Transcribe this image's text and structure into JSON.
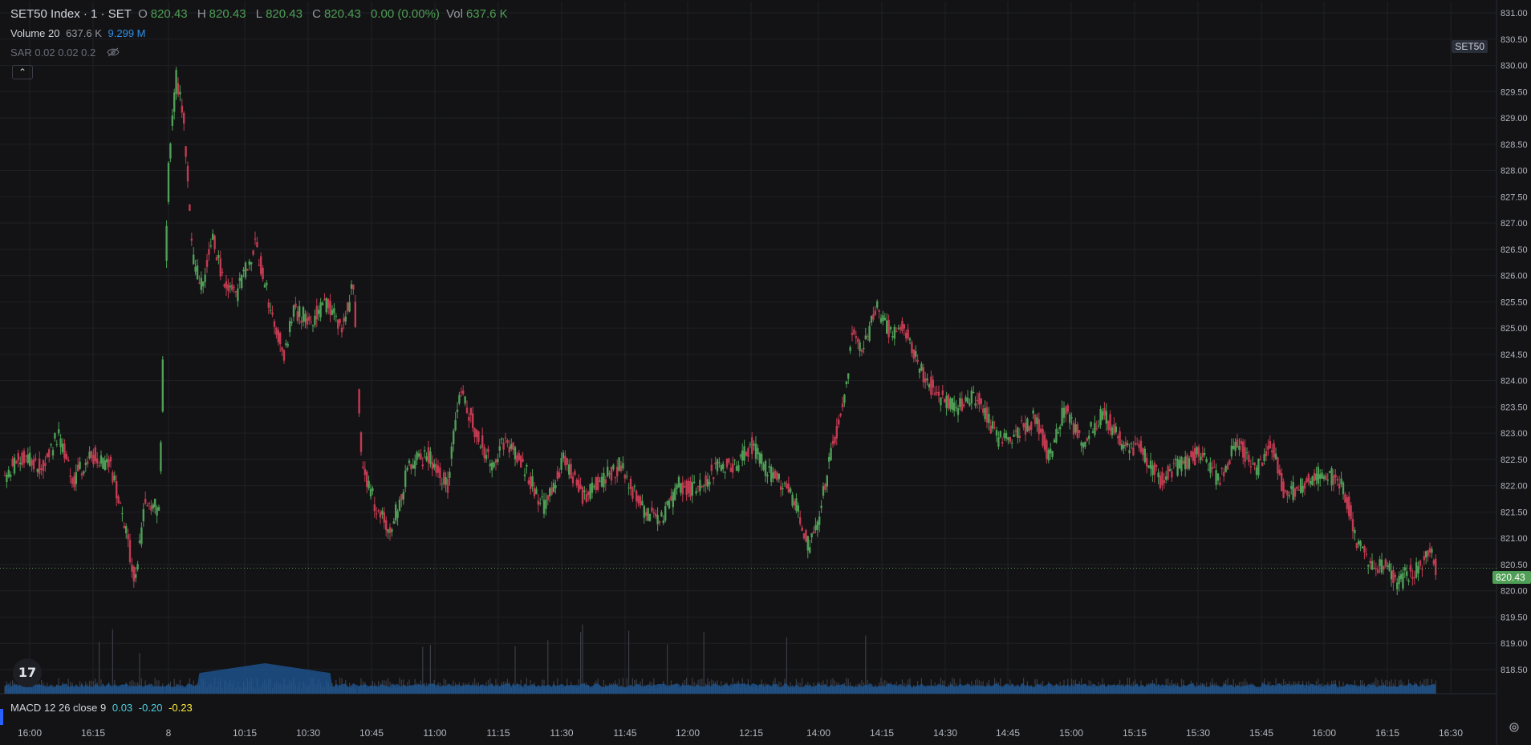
{
  "legend": {
    "symbol": "SET50 Index · 1 · SET",
    "open_label": "O",
    "open": "820.43",
    "high_label": "H",
    "high": "820.43",
    "low_label": "L",
    "low": "820.43",
    "close_label": "C",
    "close": "820.43",
    "change": "0.00 (0.00%)",
    "vol_label": "Vol",
    "vol": "637.6 K"
  },
  "volume_indicator": {
    "label": "Volume 20",
    "value": "637.6 K",
    "ma": "9.299 M"
  },
  "sar_indicator": {
    "label": "SAR 0.02 0.02 0.2"
  },
  "macd_indicator": {
    "label": "MACD 12 26 close 9",
    "macd": "0.03",
    "signal": "-0.20",
    "hist": "-0.23"
  },
  "symbol_tag": "SET50",
  "last_price_tag": "820.43",
  "logo_text": "17",
  "colors": {
    "background": "#131315",
    "up": "#4f9f56",
    "down": "#c23b52",
    "volume_ma": "#1e5a99",
    "grid": "#1f2026"
  },
  "icons": [
    "chevron-up-icon",
    "eye-hidden-icon",
    "tradingview-logo-icon",
    "settings-icon"
  ],
  "chart_data": {
    "type": "candlestick",
    "y_ticks": [
      "831.00",
      "830.50",
      "830.00",
      "829.50",
      "829.00",
      "828.50",
      "828.00",
      "827.50",
      "827.00",
      "826.50",
      "826.00",
      "825.50",
      "825.00",
      "824.50",
      "824.00",
      "823.50",
      "823.00",
      "822.50",
      "822.00",
      "821.50",
      "821.00",
      "820.50",
      "820.00",
      "819.50",
      "819.00",
      "818.50"
    ],
    "ylim": [
      818.3,
      831.1
    ],
    "x_ticks": [
      "16:00",
      "16:15",
      "8",
      "10:15",
      "10:30",
      "10:45",
      "11:00",
      "11:15",
      "11:30",
      "11:45",
      "12:00",
      "12:15",
      "14:00",
      "14:15",
      "14:30",
      "14:45",
      "15:00",
      "15:15",
      "15:30",
      "15:45",
      "16:00",
      "16:15",
      "16:30"
    ],
    "last_price": 820.43,
    "price_anchors": [
      [
        0,
        822.2
      ],
      [
        20,
        822.6
      ],
      [
        40,
        822.3
      ],
      [
        55,
        823.0
      ],
      [
        70,
        822.1
      ],
      [
        90,
        822.6
      ],
      [
        110,
        822.4
      ],
      [
        125,
        821.2
      ],
      [
        135,
        820.2
      ],
      [
        145,
        821.6
      ],
      [
        160,
        821.6
      ],
      [
        170,
        828.2
      ],
      [
        178,
        829.8
      ],
      [
        185,
        829.0
      ],
      [
        195,
        826.3
      ],
      [
        205,
        825.8
      ],
      [
        215,
        826.8
      ],
      [
        225,
        826.0
      ],
      [
        240,
        825.6
      ],
      [
        260,
        826.6
      ],
      [
        280,
        825.1
      ],
      [
        290,
        824.5
      ],
      [
        300,
        825.3
      ],
      [
        320,
        825.2
      ],
      [
        335,
        825.5
      ],
      [
        350,
        825.0
      ],
      [
        362,
        825.8
      ],
      [
        370,
        822.5
      ],
      [
        385,
        821.6
      ],
      [
        400,
        821.2
      ],
      [
        410,
        821.7
      ],
      [
        420,
        822.4
      ],
      [
        440,
        822.6
      ],
      [
        460,
        822.0
      ],
      [
        472,
        823.8
      ],
      [
        490,
        823.0
      ],
      [
        505,
        822.4
      ],
      [
        520,
        822.9
      ],
      [
        540,
        822.3
      ],
      [
        560,
        821.6
      ],
      [
        580,
        822.5
      ],
      [
        600,
        821.8
      ],
      [
        620,
        822.1
      ],
      [
        640,
        822.4
      ],
      [
        660,
        821.6
      ],
      [
        680,
        821.3
      ],
      [
        700,
        822.0
      ],
      [
        720,
        821.9
      ],
      [
        740,
        822.4
      ],
      [
        760,
        822.4
      ],
      [
        775,
        822.8
      ],
      [
        790,
        822.3
      ],
      [
        810,
        822.0
      ],
      [
        825,
        821.5
      ],
      [
        835,
        820.8
      ],
      [
        845,
        821.4
      ],
      [
        860,
        822.8
      ],
      [
        872,
        823.6
      ],
      [
        880,
        824.9
      ],
      [
        892,
        824.6
      ],
      [
        905,
        825.4
      ],
      [
        920,
        824.9
      ],
      [
        935,
        825.0
      ],
      [
        950,
        824.2
      ],
      [
        970,
        823.7
      ],
      [
        990,
        823.5
      ],
      [
        1010,
        823.7
      ],
      [
        1030,
        822.9
      ],
      [
        1050,
        823.0
      ],
      [
        1070,
        823.3
      ],
      [
        1085,
        822.5
      ],
      [
        1100,
        823.5
      ],
      [
        1120,
        822.8
      ],
      [
        1140,
        823.4
      ],
      [
        1160,
        822.8
      ],
      [
        1180,
        822.7
      ],
      [
        1200,
        822.1
      ],
      [
        1220,
        822.4
      ],
      [
        1240,
        822.6
      ],
      [
        1260,
        822.1
      ],
      [
        1280,
        822.8
      ],
      [
        1300,
        822.3
      ],
      [
        1315,
        822.8
      ],
      [
        1330,
        821.8
      ],
      [
        1345,
        822.0
      ],
      [
        1360,
        822.2
      ],
      [
        1375,
        822.2
      ],
      [
        1390,
        822.0
      ],
      [
        1405,
        820.9
      ],
      [
        1420,
        820.4
      ],
      [
        1435,
        820.5
      ],
      [
        1445,
        820.1
      ],
      [
        1460,
        820.4
      ],
      [
        1470,
        820.4
      ],
      [
        1480,
        820.9
      ],
      [
        1486,
        820.43
      ]
    ]
  }
}
